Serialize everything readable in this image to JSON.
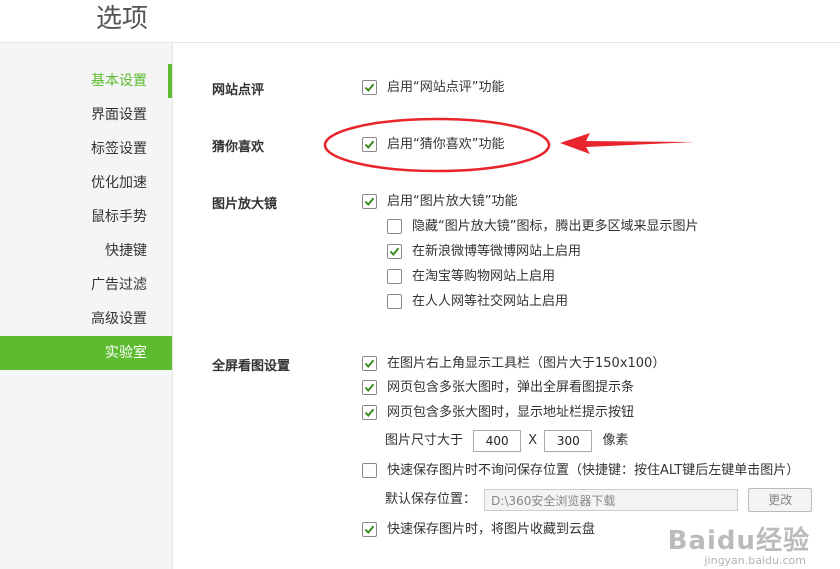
{
  "window": {
    "title": "选项"
  },
  "sidebar": {
    "items": [
      {
        "label": "基本设置"
      },
      {
        "label": "界面设置"
      },
      {
        "label": "标签设置"
      },
      {
        "label": "优化加速"
      },
      {
        "label": "鼠标手势"
      },
      {
        "label": "快捷键"
      },
      {
        "label": "广告过滤"
      },
      {
        "label": "高级设置"
      },
      {
        "label": "实验室"
      }
    ],
    "active_text_item": "基本设置",
    "selected_item": "实验室"
  },
  "sections": {
    "site_review": {
      "label": "网站点评",
      "options": [
        {
          "label": "启用“网站点评”功能",
          "checked": true
        }
      ]
    },
    "guess_you_like": {
      "label": "猜你喜欢",
      "options": [
        {
          "label": "启用“猜你喜欢”功能",
          "checked": true
        }
      ]
    },
    "image_magnifier": {
      "label": "图片放大镜",
      "options": [
        {
          "label": "启用“图片放大镜”功能",
          "checked": true
        },
        {
          "label": "隐藏“图片放大镜”图标，腾出更多区域来显示图片",
          "checked": false
        },
        {
          "label": "在新浪微博等微博网站上启用",
          "checked": true
        },
        {
          "label": "在淘宝等购物网站上启用",
          "checked": false
        },
        {
          "label": "在人人网等社交网站上启用",
          "checked": false
        }
      ]
    },
    "fullscreen_view": {
      "label": "全屏看图设置",
      "options": [
        {
          "label": "在图片右上角显示工具栏（图片大于150x100）",
          "checked": true
        },
        {
          "label": "网页包含多张大图时，弹出全屏看图提示条",
          "checked": true
        },
        {
          "label": "网页包含多张大图时，显示地址栏提示按钮",
          "checked": true
        },
        {
          "label": "快速保存图片时不询问保存位置（快捷键：按住ALT键后左键单击图片）",
          "checked": false
        },
        {
          "label": "快速保存图片时，将图片收藏到云盘",
          "checked": true
        }
      ],
      "size_row": {
        "label": "图片尺寸大于",
        "width": "400",
        "separator": "X",
        "height": "300",
        "unit": "像素"
      },
      "save_location": {
        "label": "默认保存位置：",
        "path": "D:\\360安全浏览器下载",
        "button": "更改"
      }
    }
  },
  "watermark": {
    "logo": "Baidu经验",
    "sub": "jingyan.baidu.com"
  },
  "colors": {
    "accent_green": "#5dbb2f",
    "annotation_red": "#e8242c",
    "checkmark": "#3a8a1e"
  },
  "icons": {
    "checkbox_checked": "checkmark-icon",
    "annotation_arrow": "arrow-left-icon"
  }
}
